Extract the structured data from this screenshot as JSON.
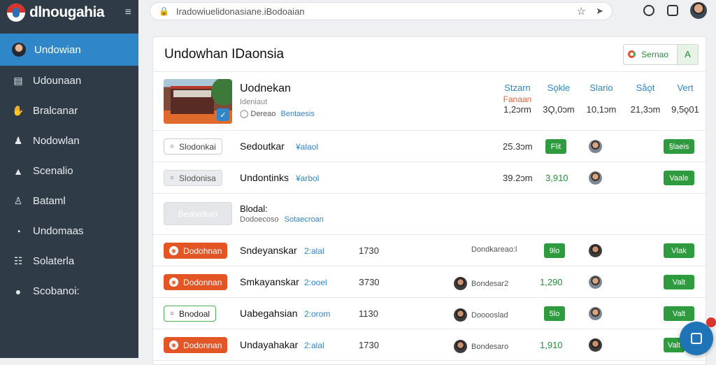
{
  "brand": {
    "name": "dlnougahia"
  },
  "sidebar": {
    "items": [
      {
        "label": "Undowian",
        "icon": "user-avatar-icon",
        "active": true
      },
      {
        "label": "Udounaan",
        "icon": "list-icon"
      },
      {
        "label": "Bralcanar",
        "icon": "hand-icon"
      },
      {
        "label": "Nodowlan",
        "icon": "users-icon"
      },
      {
        "label": "Scenalio",
        "icon": "bell-icon"
      },
      {
        "label": "Bataml",
        "icon": "person-card-icon"
      },
      {
        "label": "Undomaas",
        "icon": "circle-icon"
      },
      {
        "label": "Solaterla",
        "icon": "document-icon"
      },
      {
        "label": "Scobanoi:",
        "icon": "info-icon"
      }
    ]
  },
  "browser": {
    "url": "Iradowiuelidonasiane.iBodoaian"
  },
  "card": {
    "title": "Undowhan IDaonsia",
    "head_button_label": "Sernao",
    "head_button_icon": "A"
  },
  "feature": {
    "title": "Uodnekan",
    "subtitle": "Ideniaut",
    "meta": "Dereao",
    "meta_link": "Bentaesis",
    "stats": [
      {
        "header": "Stzarn",
        "sub": "Fanaan",
        "value": "1,2ɔrm"
      },
      {
        "header": "Sǫkle",
        "value": "3Ǫ,0ɔm"
      },
      {
        "header": "Slario",
        "value": "10,1ɔm"
      },
      {
        "header": "Såǫt",
        "value": "21,3ɔm"
      },
      {
        "header": "Vert",
        "value": "9,5ǫ01"
      }
    ]
  },
  "rows": [
    {
      "pill": "Slodonkai",
      "pill_style": "outline",
      "name": "Sedoutkar",
      "link": "¥alaol",
      "num": "25.3ɔm",
      "badge": "Flit",
      "action": "§laeis"
    },
    {
      "pill": "Slodonisa",
      "pill_style": "gray",
      "name": "Undontinks",
      "link": "¥arbol",
      "num": "39.2ɔm",
      "green": "3,910",
      "action": "Vaale"
    }
  ],
  "section": {
    "button": "Bedoalkan",
    "title": "Blodal:",
    "sub": "Dodoecoso",
    "sub_link": "Sotaecroan"
  },
  "list": [
    {
      "pill": "Dodohnan",
      "pill_style": "orange",
      "name": "Sndeyanskar",
      "link": "2:alal",
      "num": "1730",
      "mid_label": "Dondkareao:l",
      "badge": "9lo",
      "action": "Vlak"
    },
    {
      "pill": "Dodonnan",
      "pill_style": "orange",
      "name": "Smkayanskar",
      "link": "2:ooel",
      "num": "З730",
      "mid_label": "Bondesar2",
      "green": "1,290",
      "action": "Valt"
    },
    {
      "pill": "Bnodoal",
      "pill_style": "greenol",
      "name": "Uabegahsian",
      "link": "2:orom",
      "num": "1130",
      "mid_label": "Dooooslad",
      "badge": "5lo",
      "action": "Valt"
    },
    {
      "pill": "Dodonnan",
      "pill_style": "orange",
      "name": "Undayahakar",
      "link": "2:alal",
      "num": "1730",
      "mid_label": "Bondesaro",
      "green": "1,910",
      "action": "Valt"
    }
  ]
}
